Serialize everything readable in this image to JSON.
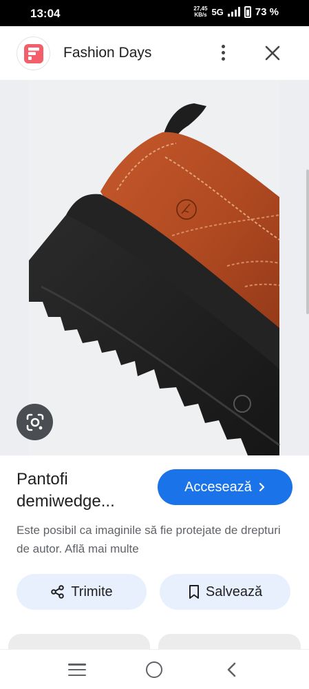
{
  "status_bar": {
    "time": "13:04",
    "net_speed_value": "27,45",
    "net_speed_unit": "KB/s",
    "network": "5G",
    "battery": "73 %",
    "battery_level_percent": 73
  },
  "header": {
    "title": "Fashion Days",
    "logo_icon": "fashion-days-logo",
    "menu_icon": "more-vert-icon",
    "close_icon": "close-icon"
  },
  "image": {
    "subject": "product-photo",
    "lens_icon": "google-lens-icon"
  },
  "product": {
    "title": "Pantofi demiwedge...",
    "access_button": "Accesează",
    "copyright_notice": "Este posibil ca imaginile să fie protejate de drepturi de autor. Află mai multe"
  },
  "actions": {
    "share_label": "Trimite",
    "save_label": "Salvează"
  },
  "colors": {
    "accent": "#1a73e8",
    "action_bg": "#e8f0fe",
    "brand": "#f25f6a"
  }
}
